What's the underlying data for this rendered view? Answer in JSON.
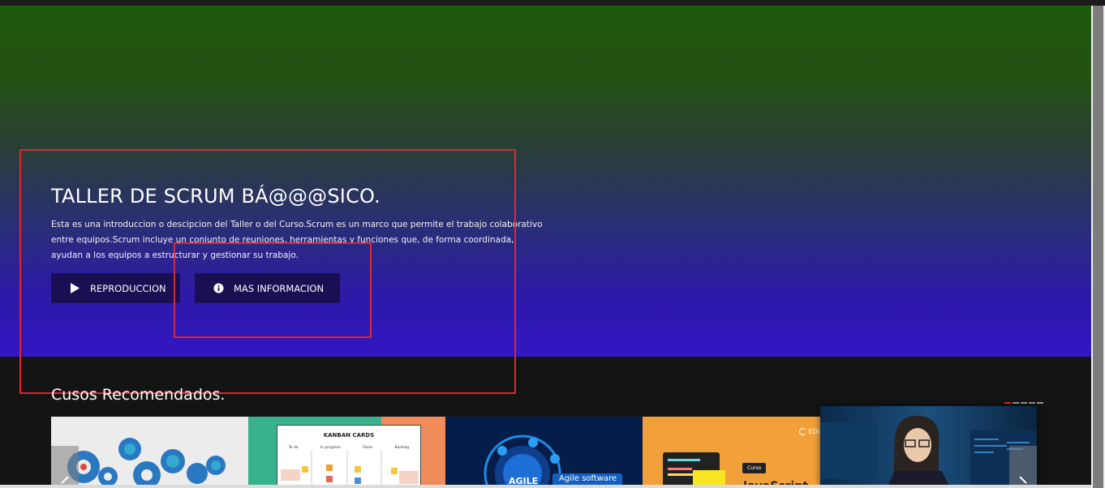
{
  "hero": {
    "title": "TALLER DE SCRUM BÁ@@@SICO.",
    "description": "Esta es una introduccion o descipcion del Taller o del Curso.Scrum es un marco que permite el trabajo colaborativo entre equipos.Scrum incluye un conjunto de reuniones, herramientas y funciones que, de forma coordinada, ayudan a los equipos a estructurar y gestionar su trabajo.",
    "buttons": {
      "play_label": "REPRODUCCION",
      "info_label": "MAS INFORMACION"
    }
  },
  "recommended": {
    "title": "Cusos Recomendados.",
    "cards": [
      {
        "caption": ""
      },
      {
        "caption": "KANBAN CARDS",
        "columns": [
          "To do",
          "In progress",
          "Done",
          "Backlog"
        ]
      },
      {
        "caption": "Agile software",
        "badge": "AGILE"
      },
      {
        "caption": "Curso",
        "brand": "EDI",
        "subcaption": "JavaScript"
      },
      {
        "caption": ""
      }
    ]
  },
  "colors": {
    "hero_top": "#1e5a0c",
    "hero_bottom": "#3316c3",
    "button_bg": "#1a0f52",
    "highlight": "#e0262c"
  },
  "icons": {
    "play": "play-icon",
    "info": "info-icon",
    "prev": "chevron-left-icon",
    "next": "chevron-right-icon"
  }
}
